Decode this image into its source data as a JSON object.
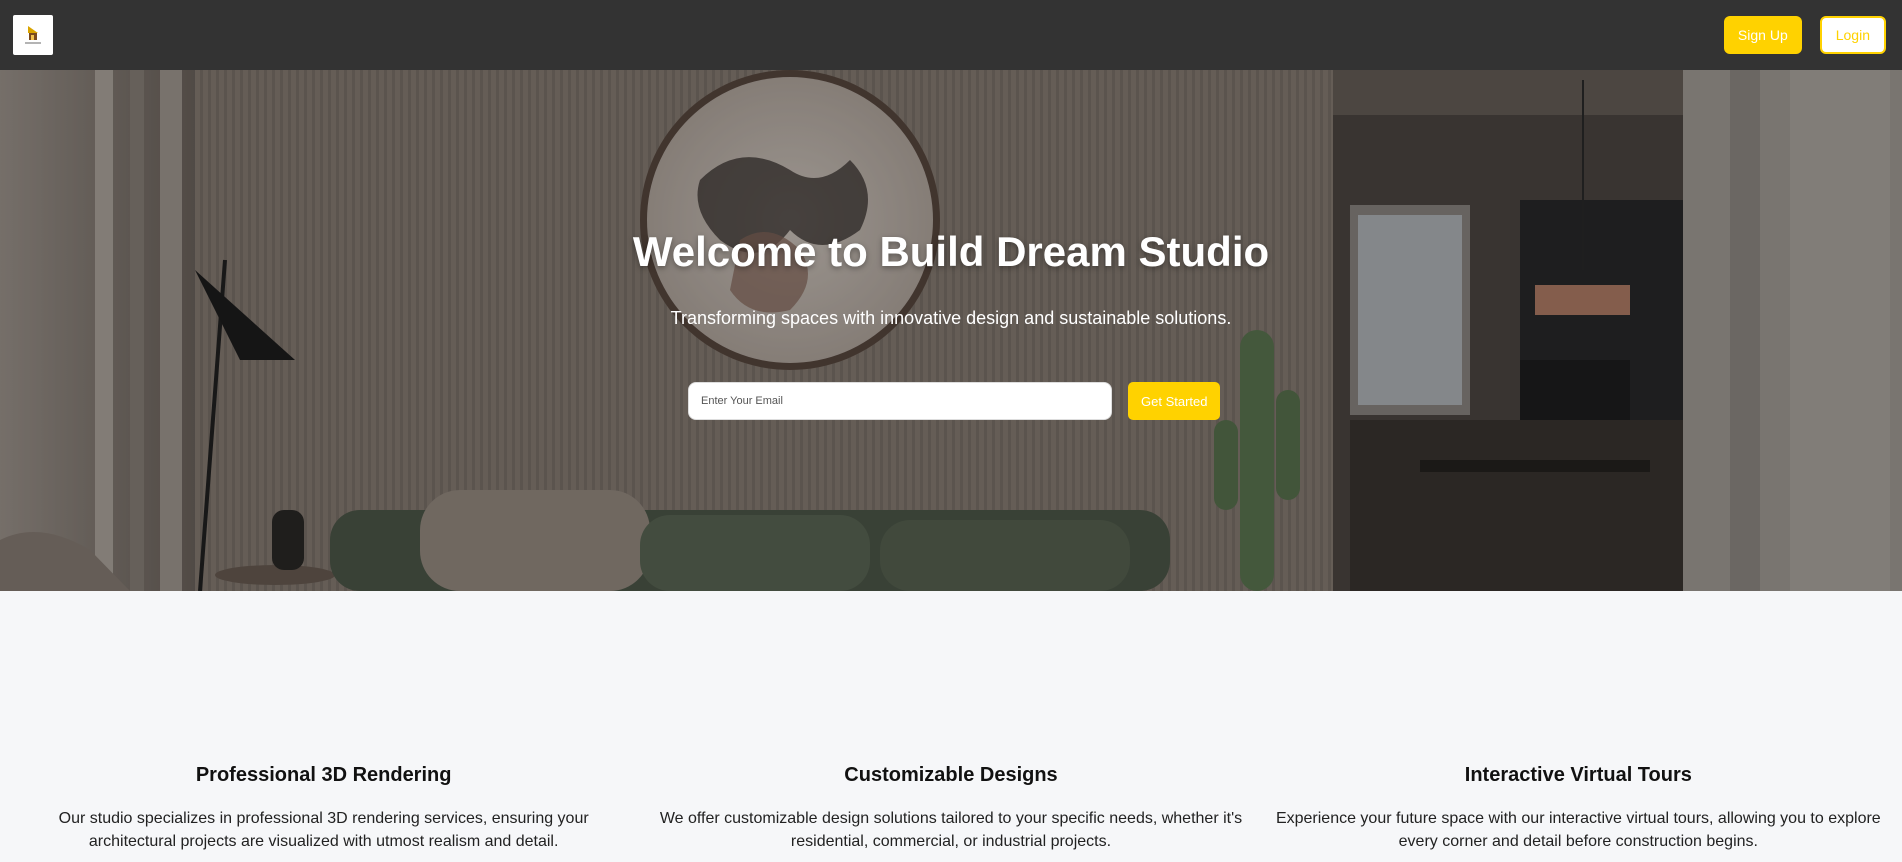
{
  "nav": {
    "logo_icon": "house-logo-icon",
    "signup_label": "Sign Up",
    "login_label": "Login",
    "background": "#333333",
    "accent": "#ffd200"
  },
  "hero": {
    "title": "Welcome to Build Dream Studio",
    "subtitle": "Transforming spaces with innovative design and sustainable solutions.",
    "email_placeholder": "Enter Your Email",
    "cta_label": "Get Started"
  },
  "features": [
    {
      "title": "Professional 3D Rendering",
      "description": "Our studio specializes in professional 3D rendering services, ensuring your architectural projects are visualized with utmost realism and detail."
    },
    {
      "title": "Customizable Designs",
      "description": "We offer customizable design solutions tailored to your specific needs, whether it's residential, commercial, or industrial projects."
    },
    {
      "title": "Interactive Virtual Tours",
      "description": "Experience your future space with our interactive virtual tours, allowing you to explore every corner and detail before construction begins."
    }
  ]
}
